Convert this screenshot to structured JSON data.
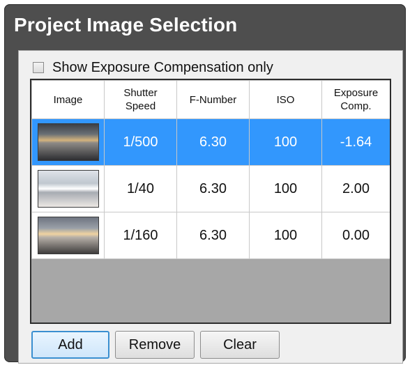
{
  "window": {
    "title": "Project Image Selection"
  },
  "options": {
    "show_exposure_label": "Show Exposure Compensation only",
    "show_exposure_checked": false
  },
  "table": {
    "columns": {
      "image": "Image",
      "shutter": "Shutter\nSpeed",
      "fnumber": "F-Number",
      "iso": "ISO",
      "exposure": "Exposure\nComp."
    },
    "rows": [
      {
        "shutter": "1/500",
        "fnumber": "6.30",
        "iso": "100",
        "exposure": "-1.64",
        "selected": true,
        "thumb": "cityscape-dark-icon"
      },
      {
        "shutter": "1/40",
        "fnumber": "6.30",
        "iso": "100",
        "exposure": "2.00",
        "selected": false,
        "thumb": "cityscape-bright-icon"
      },
      {
        "shutter": "1/160",
        "fnumber": "6.30",
        "iso": "100",
        "exposure": "0.00",
        "selected": false,
        "thumb": "cityscape-mid-icon"
      }
    ]
  },
  "buttons": {
    "add": "Add",
    "remove": "Remove",
    "clear": "Clear"
  },
  "colors": {
    "selection": "#3297fd",
    "frame": "#4e4e4e",
    "focus": "#3a8fd0"
  }
}
